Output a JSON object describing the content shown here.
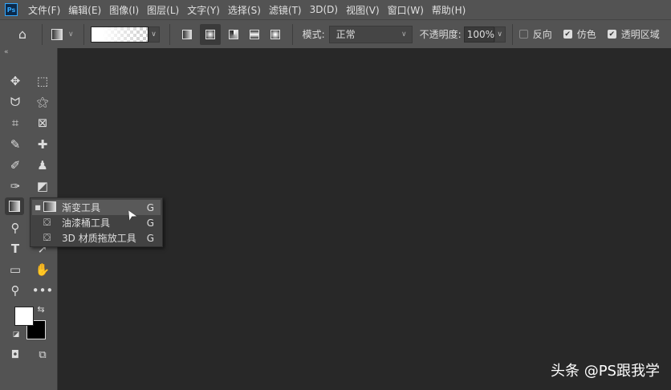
{
  "app": {
    "logo": "Ps"
  },
  "menu": [
    "文件(F)",
    "编辑(E)",
    "图像(I)",
    "图层(L)",
    "文字(Y)",
    "选择(S)",
    "滤镜(T)",
    "3D(D)",
    "视图(V)",
    "窗口(W)",
    "帮助(H)"
  ],
  "options": {
    "mode_label": "模式:",
    "mode_value": "正常",
    "opacity_label": "不透明度:",
    "opacity_value": "100%",
    "reverse": {
      "label": "反向",
      "checked": false
    },
    "dither": {
      "label": "仿色",
      "checked": true
    },
    "transparency": {
      "label": "透明区域",
      "checked": true
    }
  },
  "flyout": [
    {
      "label": "渐变工具",
      "key": "G",
      "selected": true
    },
    {
      "label": "油漆桶工具",
      "key": "G"
    },
    {
      "label": "3D 材质拖放工具",
      "key": "G"
    }
  ],
  "watermark": "头条 @PS跟我学"
}
